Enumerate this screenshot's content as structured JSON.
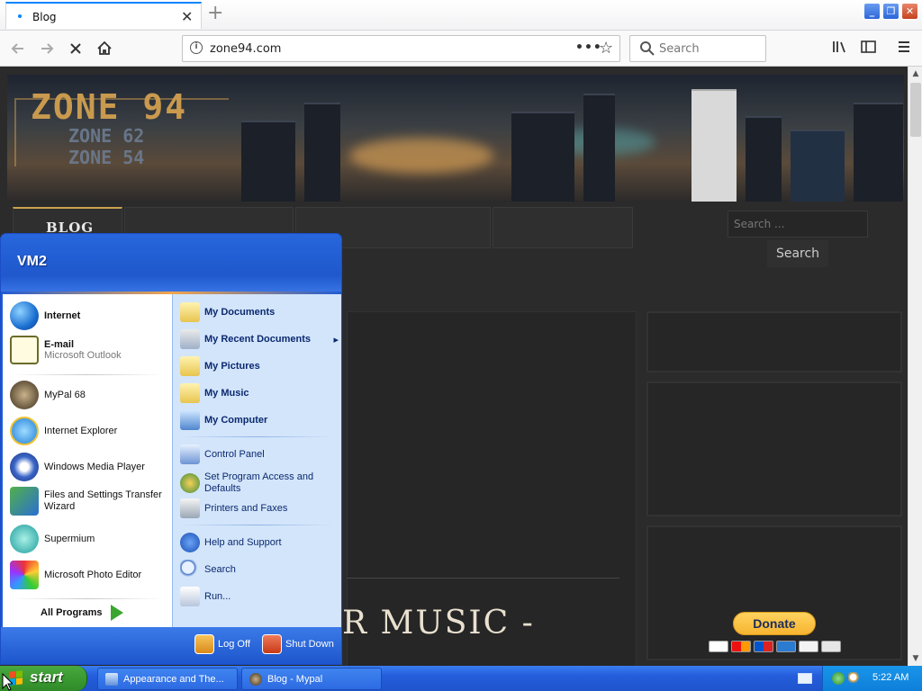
{
  "browser": {
    "tab_title": "Blog",
    "tab_close": "✕",
    "new_tab": "+",
    "url": "zone94.com",
    "page_actions": "•••",
    "search_placeholder": "Search"
  },
  "window_controls": {
    "minimize": "_",
    "restore": "❐",
    "close": "✕"
  },
  "site": {
    "logo_main": "ZONE 94",
    "logo_line1": "ZONE 62",
    "logo_line2": "ZONE 54",
    "nav_blog": "BLOG",
    "search_placeholder": "Search ...",
    "search_button": "Search",
    "heading_fragment": "R MUSIC -",
    "donate_label": "Donate"
  },
  "start_menu": {
    "user": "VM2",
    "pinned": [
      {
        "label": "Internet",
        "sublabel": ""
      },
      {
        "label": "E-mail",
        "sublabel": "Microsoft Outlook"
      }
    ],
    "recent": [
      {
        "label": "MyPal 68"
      },
      {
        "label": "Internet Explorer"
      },
      {
        "label": "Windows Media Player"
      },
      {
        "label": "Files and Settings Transfer Wizard"
      },
      {
        "label": "Supermium"
      },
      {
        "label": "Microsoft Photo Editor"
      }
    ],
    "all_programs": "All Programs",
    "places": [
      {
        "label": "My Documents"
      },
      {
        "label": "My Recent Documents",
        "arrow": "▸"
      },
      {
        "label": "My Pictures"
      },
      {
        "label": "My Music"
      },
      {
        "label": "My Computer"
      }
    ],
    "system": [
      {
        "label": "Control Panel"
      },
      {
        "label": "Set Program Access and Defaults"
      },
      {
        "label": "Printers and Faxes"
      }
    ],
    "help": [
      {
        "label": "Help and Support"
      },
      {
        "label": "Search"
      },
      {
        "label": "Run..."
      }
    ],
    "log_off": "Log Off",
    "shut_down": "Shut Down"
  },
  "taskbar": {
    "start_label": "start",
    "tasks": [
      {
        "label": "Appearance and The..."
      },
      {
        "label": "Blog - Mypal"
      }
    ],
    "clock": "5:22 AM"
  },
  "colors": {
    "xp_blue": "#245ddb",
    "start_green": "#3b9a32",
    "firefox_accent": "#0a84ff",
    "gold": "#c99a4e"
  }
}
